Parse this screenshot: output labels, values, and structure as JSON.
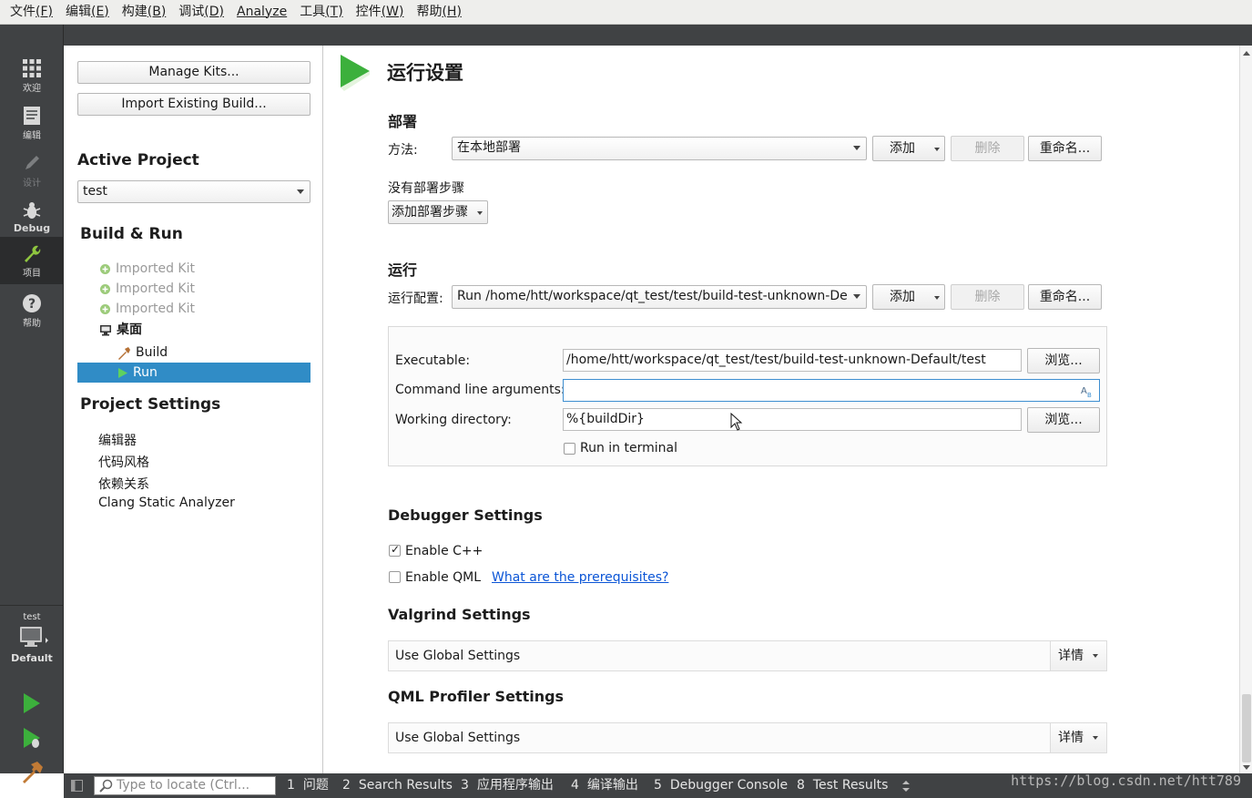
{
  "menubar": {
    "items": [
      {
        "label": "文件",
        "mnemonic": "(F)"
      },
      {
        "label": "编辑",
        "mnemonic": "(E)"
      },
      {
        "label": "构建",
        "mnemonic": "(B)"
      },
      {
        "label": "调试",
        "mnemonic": "(D)"
      },
      {
        "label": "Analyze",
        "mnemonic": ""
      },
      {
        "label": "工具",
        "mnemonic": "(T)"
      },
      {
        "label": "控件",
        "mnemonic": "(W)"
      },
      {
        "label": "帮助",
        "mnemonic": "(H)"
      }
    ]
  },
  "modebar": {
    "modes": [
      {
        "label": "欢迎",
        "icon": "grid-icon"
      },
      {
        "label": "编辑",
        "icon": "document-icon"
      },
      {
        "label": "设计",
        "icon": "pencil-icon"
      },
      {
        "label": "Debug",
        "icon": "bug-icon"
      },
      {
        "label": "项目",
        "icon": "wrench-icon"
      },
      {
        "label": "帮助",
        "icon": "question-icon"
      }
    ],
    "kit": {
      "project": "test",
      "kit": "Default"
    }
  },
  "nav": {
    "manage_kits": "Manage Kits...",
    "import_build": "Import Existing Build...",
    "active_project_heading": "Active Project",
    "active_project": "test",
    "build_run_heading": "Build & Run",
    "kits": [
      "Imported Kit",
      "Imported Kit",
      "Imported Kit"
    ],
    "desktop_kit": "桌面",
    "build": "Build",
    "run": "Run",
    "project_settings_heading": "Project Settings",
    "project_settings": [
      "编辑器",
      "代码风格",
      "依赖关系",
      "Clang Static Analyzer"
    ]
  },
  "main": {
    "title": "运行设置",
    "deploy": {
      "heading": "部署",
      "method_label": "方法:",
      "method_value": "在本地部署",
      "add": "添加",
      "remove": "删除",
      "rename": "重命名...",
      "no_steps": "没有部署步骤",
      "add_step": "添加部署步骤"
    },
    "run": {
      "heading": "运行",
      "config_label": "运行配置:",
      "config_value": "Run /home/htt/workspace/qt_test/test/build-test-unknown-De",
      "add": "添加",
      "remove": "删除",
      "rename": "重命名...",
      "executable_label": "Executable:",
      "executable_value": "/home/htt/workspace/qt_test/test/build-test-unknown-Default/test",
      "browse": "浏览...",
      "args_label": "Command line arguments:",
      "args_value": "",
      "workdir_label": "Working directory:",
      "workdir_value": "%{buildDir}",
      "browse2": "浏览...",
      "run_in_terminal": "Run in terminal",
      "run_in_terminal_checked": false
    },
    "debugger": {
      "heading": "Debugger Settings",
      "enable_cpp": "Enable C++",
      "enable_cpp_checked": true,
      "enable_qml": "Enable QML",
      "enable_qml_checked": false,
      "prereq_link": "What are the prerequisites?"
    },
    "valgrind": {
      "heading": "Valgrind Settings",
      "value": "Use Global Settings",
      "details": "详情"
    },
    "qml_profiler": {
      "heading": "QML Profiler Settings",
      "value": "Use Global Settings",
      "details": "详情"
    }
  },
  "statusbar": {
    "locator_placeholder": "Type to locate (Ctrl...",
    "tabs": [
      {
        "num": "1",
        "label": "问题"
      },
      {
        "num": "2",
        "label": "Search Results"
      },
      {
        "num": "3",
        "label": "应用程序输出"
      },
      {
        "num": "4",
        "label": "编译输出"
      },
      {
        "num": "5",
        "label": "Debugger Console"
      },
      {
        "num": "8",
        "label": "Test Results"
      }
    ]
  },
  "watermark": "https://blog.csdn.net/htt789",
  "colors": {
    "accent": "#308cc6",
    "modebar": "#404244",
    "run_green": "#3cb03c",
    "link": "#0b55d6"
  }
}
